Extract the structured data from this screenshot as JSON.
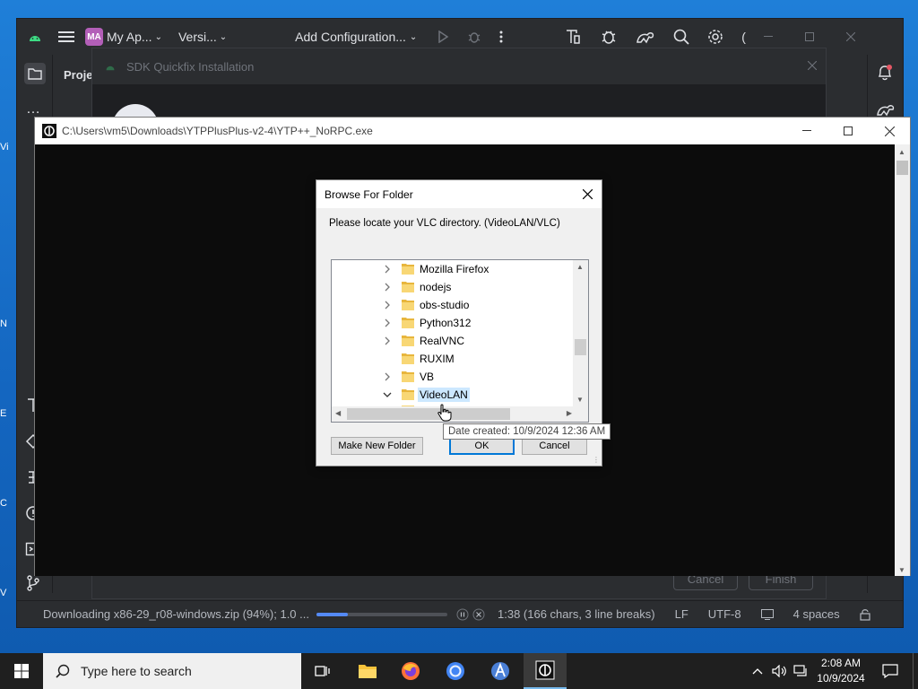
{
  "ide": {
    "project_badge": "MA",
    "project_name": "My Ap...",
    "vcs_label": "Versi...",
    "run_config": "Add Configuration...",
    "sidebar_label": "Proje",
    "status": {
      "download_text": "Downloading x86-29_r08-windows.zip (94%); 1.0 ...",
      "download_progress": 0.24,
      "cursor_pos": "1:38 (166 chars, 3 line breaks)",
      "line_ending": "LF",
      "encoding": "UTF-8",
      "indent": "4 spaces"
    },
    "paren": "("
  },
  "sdk_dialog": {
    "title": "SDK Quickfix Installation",
    "cancel_label": "Cancel",
    "finish_label": "Finish"
  },
  "ytp_window": {
    "title": "C:\\Users\\vm5\\Downloads\\YTPPlusPlus-v2-4\\YTP++_NoRPC.exe"
  },
  "browse_dialog": {
    "title": "Browse For Folder",
    "prompt": "Please locate your VLC directory. (VideoLAN/VLC)",
    "tree": [
      {
        "label": "Mozilla Firefox",
        "expandable": true,
        "expanded": false,
        "selected": false
      },
      {
        "label": "nodejs",
        "expandable": true,
        "expanded": false,
        "selected": false
      },
      {
        "label": "obs-studio",
        "expandable": true,
        "expanded": false,
        "selected": false
      },
      {
        "label": "Python312",
        "expandable": true,
        "expanded": false,
        "selected": false
      },
      {
        "label": "RealVNC",
        "expandable": true,
        "expanded": false,
        "selected": false
      },
      {
        "label": "RUXIM",
        "expandable": false,
        "expanded": false,
        "selected": false
      },
      {
        "label": "VB",
        "expandable": true,
        "expanded": false,
        "selected": false
      },
      {
        "label": "VideoLAN",
        "expandable": true,
        "expanded": true,
        "selected": true
      }
    ],
    "make_folder_label": "Make New Folder",
    "ok_label": "OK",
    "cancel_label": "Cancel",
    "tooltip": "Date created: 10/9/2024 12:36 AM"
  },
  "taskbar": {
    "search_placeholder": "Type here to search",
    "time": "2:08 AM",
    "date": "10/9/2024"
  },
  "colors": {
    "ide_bg": "#2b2d30",
    "desktop_blue": "#1570c7",
    "selection": "#cce8ff",
    "progress_blue": "#548af7"
  }
}
